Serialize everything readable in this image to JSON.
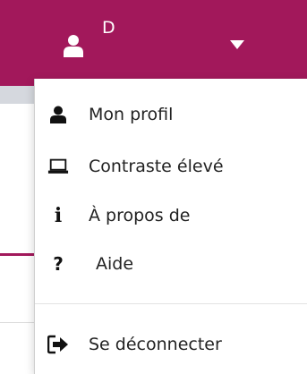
{
  "header": {
    "user_initial": "D",
    "background_color": "#a2185b",
    "user_icon": "user-icon",
    "caret_icon": "caret-down-icon"
  },
  "menu": {
    "items": [
      {
        "label": "Mon profil",
        "icon": "user-icon"
      },
      {
        "label": "Contraste élevé",
        "icon": "laptop-icon"
      },
      {
        "label": "À propos de",
        "icon": "info-icon"
      },
      {
        "label": "Aide",
        "icon": "question-icon"
      },
      {
        "label": "Se déconnecter",
        "icon": "sign-out-icon"
      }
    ]
  }
}
